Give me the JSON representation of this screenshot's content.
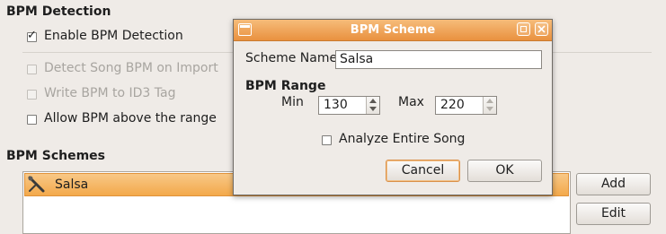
{
  "prefs": {
    "bpm_detection_header": "BPM Detection",
    "enable_bpm": {
      "label": "Enable BPM Detection",
      "checked": true
    },
    "detect_on_import": {
      "label": "Detect Song BPM on Import",
      "checked": false,
      "disabled": true
    },
    "write_id3": {
      "label": "Write BPM to ID3 Tag",
      "checked": false,
      "disabled": true
    },
    "allow_above_range": {
      "label": "Allow BPM above the range",
      "checked": false
    },
    "schemes_header": "BPM Schemes",
    "schemes_list": [
      {
        "name": "Salsa",
        "selected": true
      }
    ],
    "add_label": "Add",
    "edit_label": "Edit"
  },
  "dialog": {
    "title": "BPM Scheme",
    "scheme_name_label": "Scheme Name:",
    "scheme_name_value": "Salsa",
    "range_header": "BPM Range",
    "min_label": "Min",
    "min_value": "130",
    "max_label": "Max",
    "max_value": "220",
    "analyze_label": "Analyze Entire Song",
    "analyze_checked": false,
    "cancel_label": "Cancel",
    "ok_label": "OK"
  },
  "colors": {
    "accent": "#f3a94b",
    "window_bg": "#efebe7"
  }
}
